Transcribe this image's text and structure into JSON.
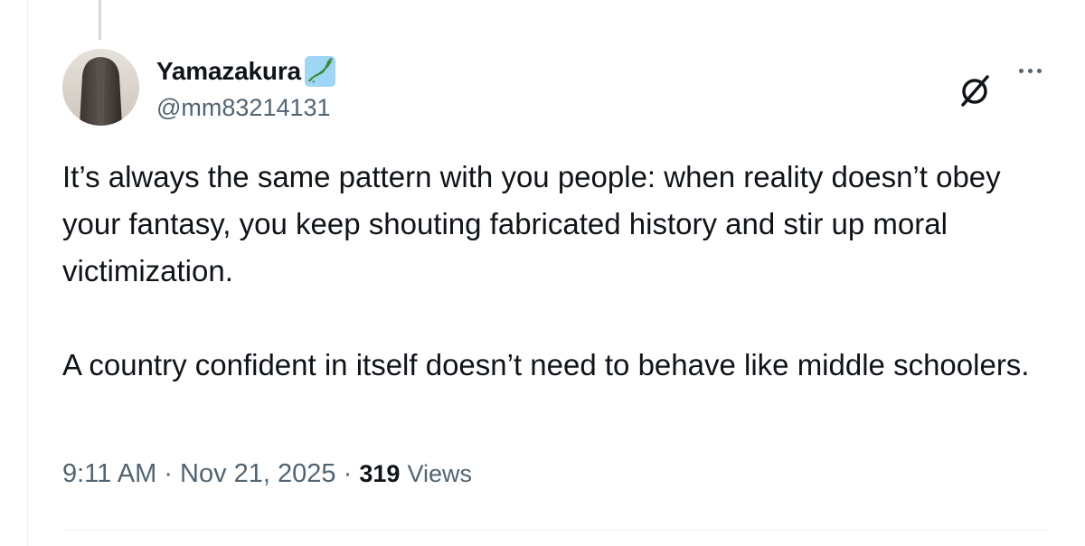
{
  "tweet": {
    "author": {
      "display_name": "Yamazakura",
      "handle": "@mm83214131",
      "flag_emoji": "japan-map-icon"
    },
    "text": [
      "It’s always the same pattern with you people: when reality doesn’t obey your fantasy, you keep shouting fabricated history and stir up moral victimization.",
      "A country confident in itself doesn’t need to behave like middle schoolers."
    ],
    "time": "9:11 AM",
    "separator": " · ",
    "date": "Nov 21, 2025",
    "views_count": "319",
    "views_label": "Views"
  },
  "colors": {
    "text_primary": "#0f1419",
    "text_secondary": "#536471",
    "border": "#eff3f4",
    "flag_bg": "#9fd6f5"
  },
  "icons": {
    "grok": "grok-slash-circle-icon",
    "more": "more-horizontal-icon"
  }
}
